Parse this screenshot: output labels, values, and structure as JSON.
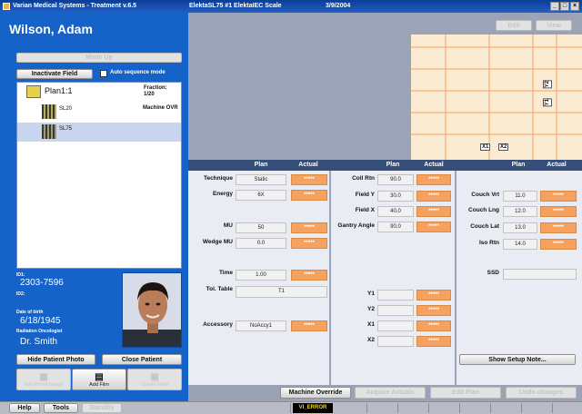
{
  "title_bar": {
    "app": "Varian Medical Systems - Treatment v.6.5",
    "machine": "ElektaSL75 #1 ElektaIEC Scale",
    "date": "3/9/2004"
  },
  "patient": {
    "name": "Wilson, Adam",
    "mode_up": "Mode Up",
    "inactivate_field": "Inactivate Field",
    "auto_sequence": "Auto sequence mode",
    "plan_name": "Plan1:1",
    "fraction_label": "Fraction:",
    "fraction_value": "1/20",
    "machine_ovr": "Machine OVR",
    "fields": [
      "SL20",
      "SL75"
    ],
    "id1_label": "ID1:",
    "id1_value": "2303-7596",
    "id2_label": "ID2:",
    "dob_label": "Date of birth",
    "dob_value": "6/18/1945",
    "oncologist_label": "Radiation Oncologist",
    "oncologist_value": "Dr. Smith",
    "hide_photo": "Hide Patient Photo",
    "close_patient": "Close Patient"
  },
  "bottom_tools": {
    "add_portal": "Add Portal Image",
    "add_film": "Add Film",
    "create_field": "Create Field"
  },
  "preview": {
    "edit": "Edit",
    "view": "View",
    "labels": [
      "X1",
      "X2",
      "Y1",
      "Y2"
    ]
  },
  "params": {
    "headers": {
      "plan": "Plan",
      "actual": "Actual"
    },
    "actual_placeholder": "*****",
    "col1": [
      {
        "label": "Technique",
        "plan": "Static"
      },
      {
        "label": "Energy",
        "plan": "6X"
      },
      {
        "label": "MU",
        "plan": "50"
      },
      {
        "label": "Wedge MU",
        "plan": "0.0"
      },
      {
        "label": "Time",
        "plan": "1.00"
      }
    ],
    "tol_table_label": "Tol. Table",
    "tol_table_value": "T1",
    "accessory_label": "Accessory",
    "accessory_value": "NoAccy1",
    "col2": [
      {
        "label": "Coll Rtn",
        "plan": "90.0"
      },
      {
        "label": "Field Y",
        "plan": "30.0"
      },
      {
        "label": "Field X",
        "plan": "40.0"
      },
      {
        "label": "Gantry Angle",
        "plan": "90.0"
      }
    ],
    "jaws": [
      {
        "label": "Y1",
        "plan": ""
      },
      {
        "label": "Y2",
        "plan": ""
      },
      {
        "label": "X1",
        "plan": ""
      },
      {
        "label": "X2",
        "plan": ""
      }
    ],
    "col3": [
      {
        "label": "Couch Vrt",
        "plan": "11.0"
      },
      {
        "label": "Couch Lng",
        "plan": "12.0"
      },
      {
        "label": "Couch Lat",
        "plan": "13.0"
      },
      {
        "label": "Iso Rtn",
        "plan": "14.0"
      }
    ],
    "ssd_label": "SSD",
    "show_setup": "Show Setup Note..."
  },
  "actions": {
    "machine_override": "Machine Override",
    "acquire_actuals": "Acquire Actuals",
    "edit_plan": "Edit Plan",
    "undo_changes": "Undo changes"
  },
  "taskbar": {
    "help": "Help",
    "tools": "Tools",
    "standby": "Standby",
    "error": "VI_ERROR"
  }
}
